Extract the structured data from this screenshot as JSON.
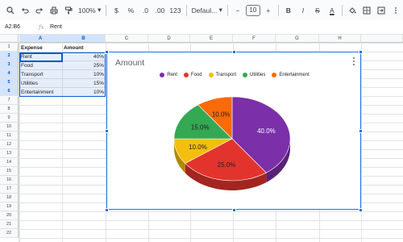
{
  "toolbar": {
    "zoom": "100%",
    "currency": "$",
    "percent": "%",
    "decrease_decimals": ".0",
    "increase_decimals": ".00",
    "number_format": "123",
    "font": "Defaul...",
    "font_size": "10",
    "minus": "−",
    "plus": "+",
    "bold": "B",
    "italic": "I",
    "strikethrough": "S",
    "text_color": "A"
  },
  "formula_bar": {
    "name_box": "A2:B6",
    "fx": "fx",
    "value": "Rent"
  },
  "columns": [
    "A",
    "B",
    "C",
    "D",
    "E",
    "F",
    "G",
    "H"
  ],
  "rows": [
    "1",
    "2",
    "3",
    "4",
    "5",
    "6",
    "7",
    "8",
    "9",
    "10",
    "11",
    "12",
    "13",
    "14",
    "15",
    "16",
    "17",
    "18",
    "19",
    "20",
    "21",
    "22"
  ],
  "sheet": {
    "headers": [
      "Expense",
      "Amount"
    ],
    "data": [
      [
        "Rent",
        "40%"
      ],
      [
        "Food",
        "25%"
      ],
      [
        "Transport",
        "10%"
      ],
      [
        "Utilities",
        "15%"
      ],
      [
        "Entertainment",
        "10%"
      ]
    ]
  },
  "chart_data": {
    "type": "pie",
    "title": "Amount",
    "categories": [
      "Rent",
      "Food",
      "Transport",
      "Utilities",
      "Entertainment"
    ],
    "values": [
      40,
      25,
      10,
      15,
      10
    ],
    "labels": [
      "40.0%",
      "25.0%",
      "10.0%",
      "15.0%",
      "10.0%"
    ],
    "colors": [
      "#7b2fa8",
      "#e2342d",
      "#f4be0e",
      "#34a853",
      "#fa6a08"
    ],
    "label_colors": [
      "#ffffff",
      "#202124",
      "#202124",
      "#202124",
      "#202124"
    ],
    "legend_position": "top",
    "style": "3d"
  },
  "colors": {
    "selection": "#0b57d0",
    "chart_border": "#1a73e8"
  }
}
